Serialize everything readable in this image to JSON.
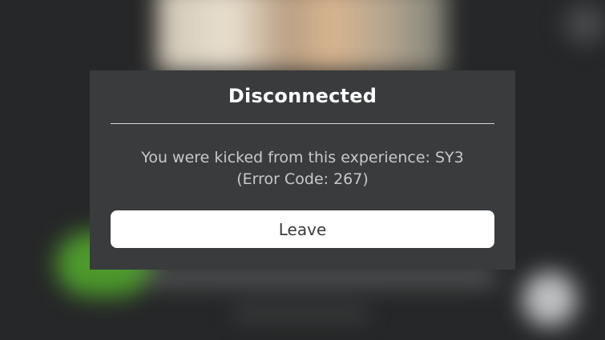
{
  "dialog": {
    "title": "Disconnected",
    "message_line1": "You were kicked from this experience: SY3",
    "message_line2": "(Error Code: 267)",
    "leave_label": "Leave"
  },
  "colors": {
    "modal_background": "#393b3d",
    "button_background": "#ffffff",
    "title_text": "#ffffff",
    "message_text": "#c8c9ca"
  }
}
